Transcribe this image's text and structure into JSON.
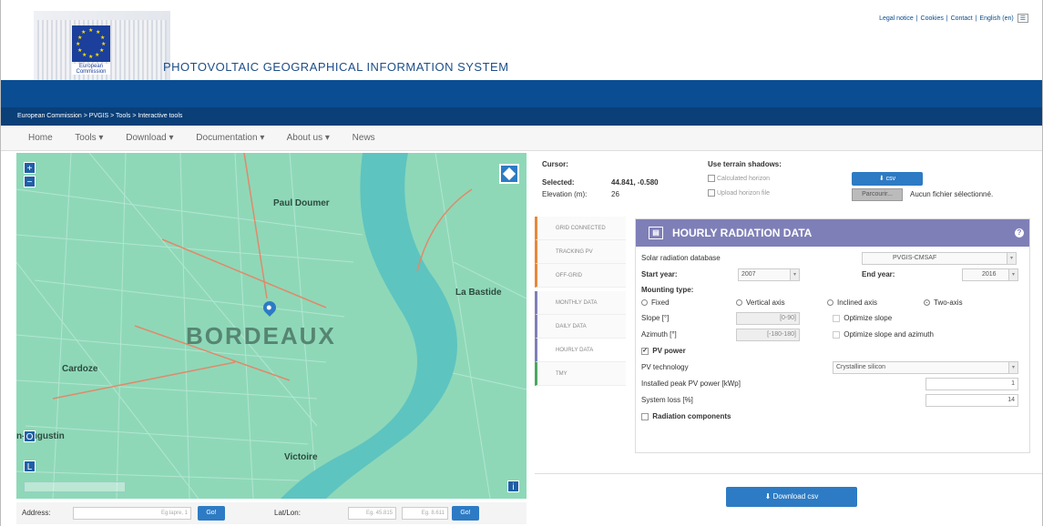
{
  "header": {
    "top_links": [
      "Legal notice",
      "Cookies",
      "Contact",
      "English (en)"
    ],
    "logo_text": "European Commission",
    "site_title": "PHOTOVOLTAIC GEOGRAPHICAL INFORMATION SYSTEM",
    "breadcrumb": "European Commission > PVGIS > Tools > Interactive tools"
  },
  "nav": {
    "items": [
      "Home",
      "Tools ▾",
      "Download ▾",
      "Documentation ▾",
      "About us ▾",
      "News"
    ]
  },
  "map": {
    "zoom_in": "+",
    "zoom_out": "−",
    "places": {
      "paul_doumer": "Paul Doumer",
      "la_bastide": "La Bastide",
      "bordeaux": "BORDEAUX",
      "cardoze": "Cardoze",
      "augustin": "n-Augustin",
      "victoire": "Victoire"
    },
    "address_label": "Address:",
    "address_placeholder": "Eg.lapre, 1",
    "go_label": "Go!",
    "latlon_label": "Lat/Lon:",
    "lat_placeholder": "Eg. 45.815",
    "lon_placeholder": "Eg. 8.611"
  },
  "cursor_panel": {
    "cursor_label": "Cursor:",
    "selected_label": "Selected:",
    "selected_value": "44.841, -0.580",
    "elevation_label": "Elevation (m):",
    "elevation_value": "26",
    "terrain_label": "Use terrain shadows:",
    "calc_horizon": "Calculated horizon",
    "upload_horizon": "Upload horizon file",
    "csv_label": "csv",
    "browse_label": "Parcourir...",
    "no_file": "Aucun fichier sélectionné."
  },
  "tabs": [
    "GRID CONNECTED",
    "TRACKING PV",
    "OFF-GRID",
    "MONTHLY DATA",
    "DAILY DATA",
    "HOURLY DATA",
    "TMY"
  ],
  "tab_colors": [
    "#e8883a",
    "#e8883a",
    "#e8883a",
    "#7f7fb8",
    "#7f7fb8",
    "#7f7fb8",
    "#4aa860"
  ],
  "form": {
    "title": "HOURLY RADIATION DATA",
    "help": "?",
    "db_label": "Solar radiation database",
    "db_value": "PVGIS-CMSAF",
    "start_label": "Start year:",
    "start_value": "2007",
    "end_label": "End year:",
    "end_value": "2016",
    "mounting_label": "Mounting type:",
    "opt_fixed": "Fixed",
    "opt_vertical": "Vertical axis",
    "opt_inclined": "Inclined axis",
    "opt_two": "Two-axis",
    "slope_label": "Slope [°]",
    "slope_value": "[0-90]",
    "azimuth_label": "Azimuth [°]",
    "azimuth_value": "[-180-180]",
    "opt_slope": "Optimize slope",
    "opt_slope_az": "Optimize slope and azimuth",
    "pv_power": "PV power",
    "pv_tech_label": "PV technology",
    "pv_tech_value": "Crystalline silicon",
    "peak_label": "Installed peak PV power [kWp]",
    "peak_value": "1",
    "loss_label": "System loss [%]",
    "loss_value": "14",
    "radiation_components": "Radiation components",
    "download_csv": "Download csv"
  },
  "colors": {
    "brand_blue": "#0a4d92",
    "map_green": "#8ed8b8",
    "river": "#5ec4c0",
    "form_header": "#7f7fb8",
    "button_blue": "#2d7bc4"
  }
}
